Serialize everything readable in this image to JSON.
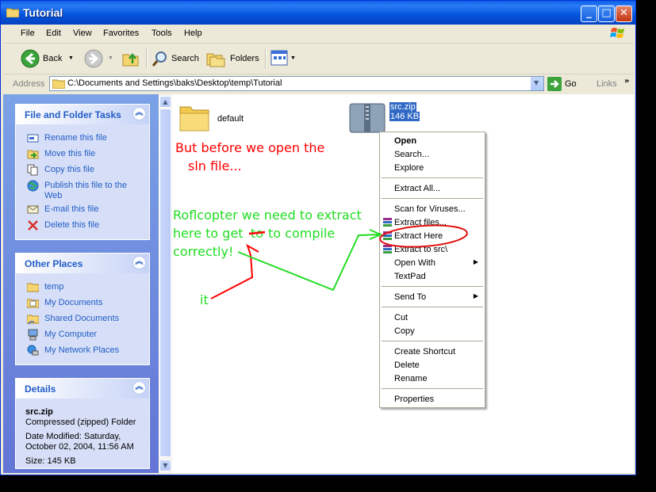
{
  "window": {
    "title": "Tutorial"
  },
  "menu": [
    "File",
    "Edit",
    "View",
    "Favorites",
    "Tools",
    "Help"
  ],
  "toolbar": {
    "back": "Back",
    "search": "Search",
    "folders": "Folders"
  },
  "address": {
    "label": "Address",
    "path": "C:\\Documents and Settings\\baks\\Desktop\\temp\\Tutorial",
    "go": "Go",
    "links": "Links"
  },
  "file_tasks": {
    "title": "File and Folder Tasks",
    "items": [
      "Rename this file",
      "Move this file",
      "Copy this file",
      "Publish this file to the",
      "Web",
      "E-mail this file",
      "Delete this file"
    ]
  },
  "other_places": {
    "title": "Other Places",
    "items": [
      "temp",
      "My Documents",
      "Shared Documents",
      "My Computer",
      "My Network Places"
    ]
  },
  "details": {
    "title": "Details",
    "name": "src.zip",
    "type": "Compressed (zipped) Folder",
    "modified_1": "Date Modified: Saturday,",
    "modified_2": "October 02, 2004, 11:56 AM",
    "size": "Size: 145 KB"
  },
  "files": [
    {
      "name": "default"
    },
    {
      "name": "src.zip",
      "size": "146 KB"
    }
  ],
  "context_menu": [
    "Open",
    "Search...",
    "Explore",
    "Extract All...",
    "Scan for Viruses...",
    "Extract files...",
    "Extract Here",
    "Extract to src\\",
    "Open With",
    "TextPad",
    "Send To",
    "Cut",
    "Copy",
    "Create Shortcut",
    "Delete",
    "Rename",
    "Properties"
  ],
  "annotations": {
    "red_1": "But before we open the",
    "red_2": "sln file...",
    "green_1": "Roflcopter we need to extract",
    "green_2a": "here to get",
    "green_2b": "to",
    "green_2c": "to compile",
    "green_3": "correctly!",
    "green_4": "it"
  },
  "colors": {
    "annotation_red": "#FF0000",
    "annotation_green": "#22DD22",
    "link_blue": "#215DC6",
    "title_blue": "#0454DD"
  }
}
